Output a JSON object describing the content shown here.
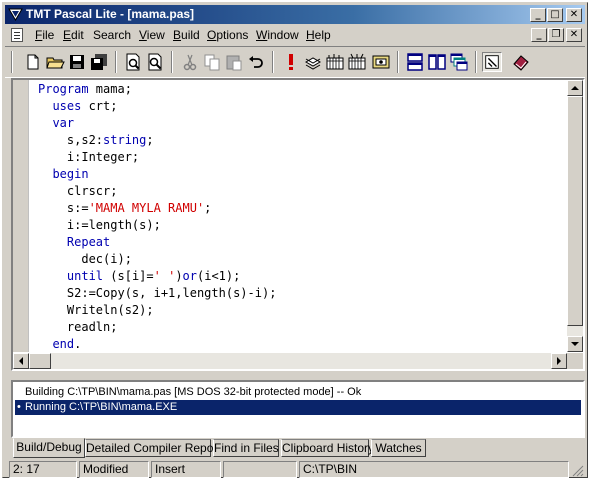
{
  "window": {
    "title": "TMT Pascal Lite - [mama.pas]",
    "title_buttons": {
      "minimize": "_",
      "maximize": "□",
      "close": "✕"
    },
    "mdi_buttons": {
      "minimize": "_",
      "restore": "❐",
      "close": "✕"
    }
  },
  "menu": {
    "items": [
      {
        "label": "File",
        "u": "F",
        "rest": "ile"
      },
      {
        "label": "Edit",
        "u": "E",
        "rest": "dit"
      },
      {
        "label": "Search",
        "u": "",
        "rest": "Search"
      },
      {
        "label": "View",
        "u": "V",
        "rest": "iew"
      },
      {
        "label": "Build",
        "u": "B",
        "rest": "uild"
      },
      {
        "label": "Options",
        "u": "O",
        "rest": "ptions"
      },
      {
        "label": "Window",
        "u": "W",
        "rest": "indow"
      },
      {
        "label": "Help",
        "u": "H",
        "rest": "elp"
      }
    ]
  },
  "toolbar": {
    "icons": [
      "new-file-icon",
      "open-folder-icon",
      "save-icon",
      "save-all-icon",
      "print-preview-icon",
      "find-icon",
      "cut-icon",
      "copy-icon",
      "paste-icon",
      "undo-icon",
      "run-icon",
      "compile-icon",
      "build-icon",
      "make-icon",
      "debug-window-icon",
      "tile-horizontal-icon",
      "tile-vertical-icon",
      "cascade-icon",
      "help-toggle-icon",
      "help-book-icon"
    ]
  },
  "editor": {
    "lines": [
      [
        {
          "t": "Program ",
          "c": "kw"
        },
        {
          "t": "mama;",
          "c": "id"
        }
      ],
      [
        {
          "t": "  "
        },
        {
          "t": "uses ",
          "c": "kw"
        },
        {
          "t": "crt;",
          "c": "id"
        }
      ],
      [
        {
          "t": "  "
        },
        {
          "t": "var",
          "c": "kw"
        }
      ],
      [
        {
          "t": "    s,s2:"
        },
        {
          "t": "string",
          "c": "kw"
        },
        {
          "t": ";"
        }
      ],
      [
        {
          "t": "    i:Integer;"
        }
      ],
      [
        {
          "t": "  "
        },
        {
          "t": "begin",
          "c": "kw"
        }
      ],
      [
        {
          "t": "    clrscr;"
        }
      ],
      [
        {
          "t": "    s:="
        },
        {
          "t": "'MAMA MYLA RAMU'",
          "c": "str"
        },
        {
          "t": ";"
        }
      ],
      [
        {
          "t": "    i:=length(s);"
        }
      ],
      [
        {
          "t": "    "
        },
        {
          "t": "Repeat",
          "c": "kw"
        }
      ],
      [
        {
          "t": "      dec(i);"
        }
      ],
      [
        {
          "t": "    "
        },
        {
          "t": "until ",
          "c": "kw"
        },
        {
          "t": "(s[i]="
        },
        {
          "t": "' '",
          "c": "str"
        },
        {
          "t": ")"
        },
        {
          "t": "or",
          "c": "kw"
        },
        {
          "t": "(i<1);"
        }
      ],
      [
        {
          "t": "    S2:=Copy(s, i+1,length(s)-i);"
        }
      ],
      [
        {
          "t": "    Writeln(s2);"
        }
      ],
      [
        {
          "t": "    readln;"
        }
      ],
      [
        {
          "t": "  "
        },
        {
          "t": "end",
          "c": "kw"
        },
        {
          "t": "."
        }
      ]
    ]
  },
  "messages": [
    {
      "text": "Building C:\\TP\\BIN\\mama.pas  [MS DOS 32-bit protected mode] -- Ok",
      "selected": false,
      "bullet": ""
    },
    {
      "text": "Running C:\\TP\\BIN\\mama.EXE",
      "selected": true,
      "bullet": "•"
    }
  ],
  "tabs": [
    "Build/Debug",
    "Detailed Compiler Report",
    "Find in Files",
    "Clipboard History",
    "Watches"
  ],
  "status": {
    "position": "2:  17",
    "modified": "Modified",
    "mode": "Insert",
    "empty": "",
    "path": "C:\\TP\\BIN"
  },
  "colors": {
    "keyword": "#0000b0",
    "string": "#d00000",
    "title_bar": "#0a246a",
    "selection": "#0a246a"
  }
}
